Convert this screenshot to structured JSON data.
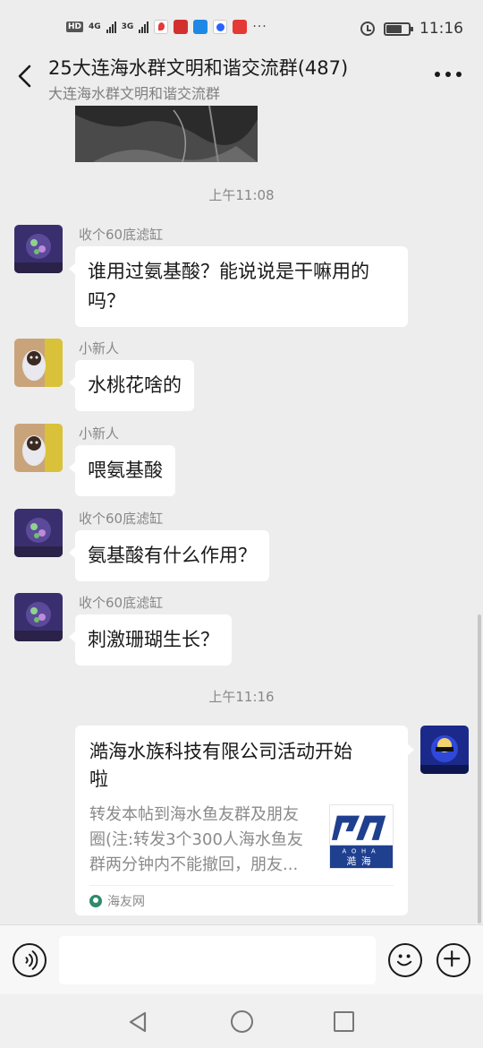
{
  "status_bar": {
    "hd": "HD",
    "net1": "4G",
    "net2": "3G",
    "more": "···",
    "time": "11:16",
    "battery_level": 0.7
  },
  "header": {
    "title": "25大连海水群文明和谐交流群(487)",
    "subtitle": "大连海水群文明和谐交流群"
  },
  "timestamps": [
    "上午11:08",
    "上午11:16"
  ],
  "messages": [
    {
      "sender": "收个60底滤缸",
      "text_lines": [
        "谁用过氨基酸？能说说是干嘛用的",
        "吗？"
      ],
      "avatar": "avatar-coral"
    },
    {
      "sender": "小新人",
      "text": "水桃花啥的",
      "avatar": "avatar-dog"
    },
    {
      "sender": "小新人",
      "text": "喂氨基酸",
      "avatar": "avatar-dog"
    },
    {
      "sender": "收个60底滤缸",
      "text": "氨基酸有什么作用？",
      "avatar": "avatar-coral"
    },
    {
      "sender": "收个60底滤缸",
      "text": "刺激珊瑚生长？",
      "avatar": "avatar-coral"
    }
  ],
  "link_card": {
    "title_lines": [
      "澔海水族科技有限公司活动开始",
      "啦"
    ],
    "desc_lines": [
      "转发本帖到海水鱼友群及朋友",
      "圈(注:转发3个300人海水鱼友",
      "群两分钟内不能撤回，朋友..."
    ],
    "thumb_text": "AOHA",
    "thumb_cn": "澔海",
    "source": "海友网"
  },
  "input": {
    "placeholder": ""
  },
  "colors": {
    "background": "#ededed",
    "bubble": "#ffffff",
    "brand_blue": "#1f3f8f"
  }
}
